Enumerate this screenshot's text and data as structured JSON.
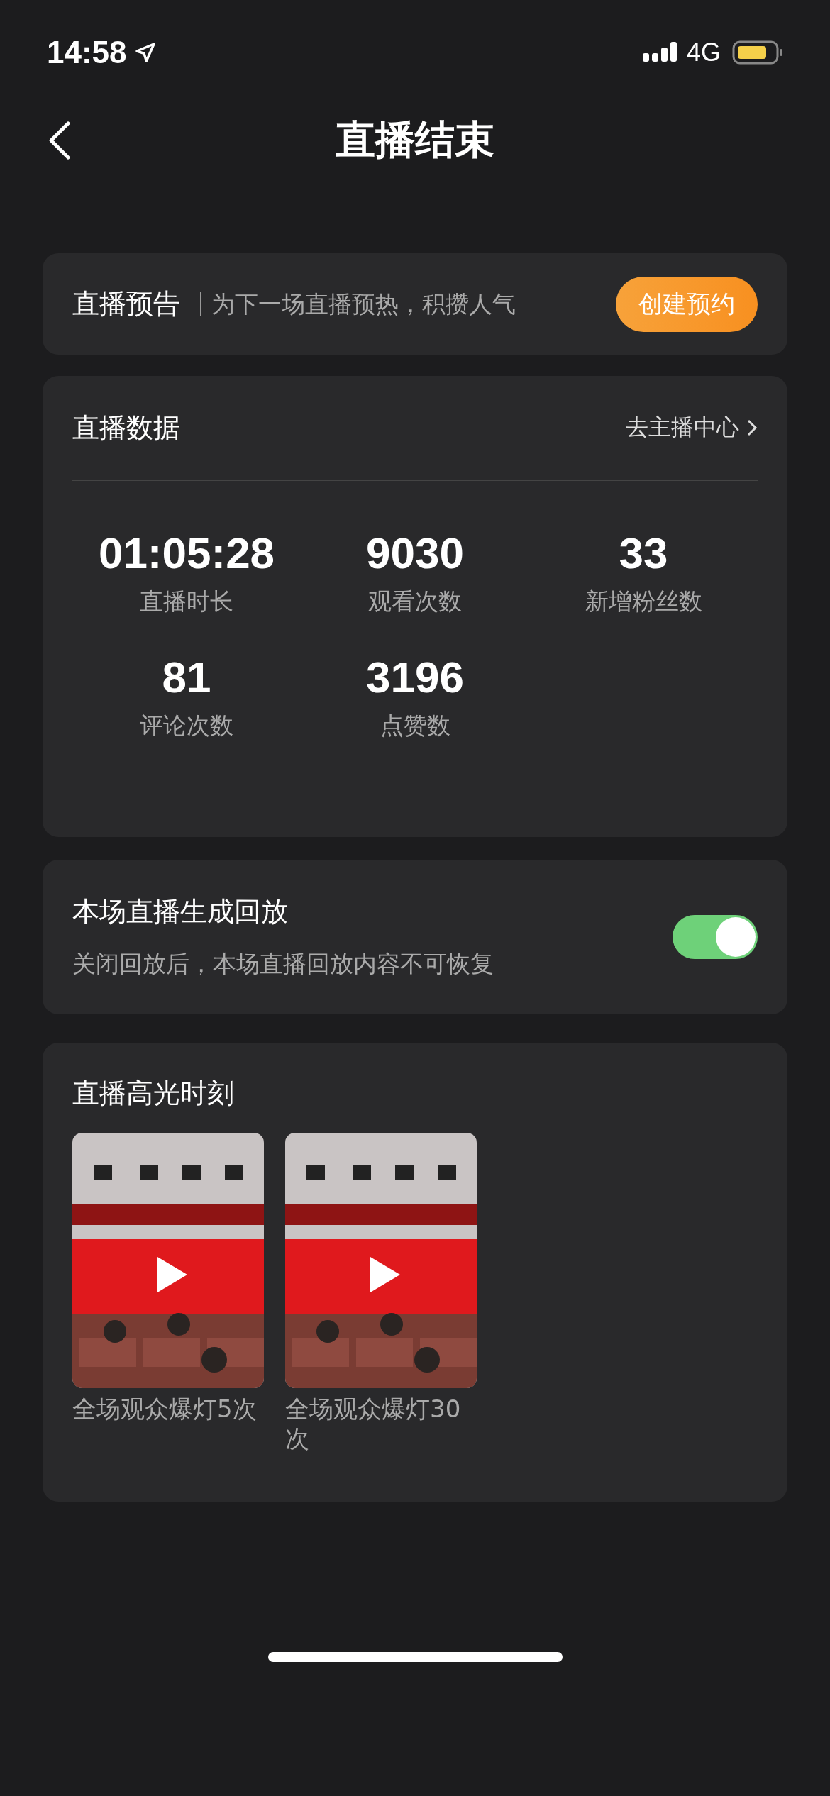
{
  "status_bar": {
    "time": "14:58",
    "network": "4G"
  },
  "nav": {
    "title": "直播结束"
  },
  "preview_card": {
    "title": "直播预告",
    "subtitle": "为下一场直播预热，积攒人气",
    "button": "创建预约"
  },
  "data_card": {
    "title": "直播数据",
    "link": "去主播中心",
    "stats": [
      {
        "value": "01:05:28",
        "label": "直播时长"
      },
      {
        "value": "9030",
        "label": "观看次数"
      },
      {
        "value": "33",
        "label": "新增粉丝数"
      },
      {
        "value": "81",
        "label": "评论次数"
      },
      {
        "value": "3196",
        "label": "点赞数"
      }
    ]
  },
  "replay_card": {
    "title": "本场直播生成回放",
    "subtitle": "关闭回放后，本场直播回放内容不可恢复",
    "on": true
  },
  "highlights_card": {
    "title": "直播高光时刻",
    "clips": [
      {
        "kind": "picture",
        "caption": "全场观众爆灯5次"
      },
      {
        "kind": "picture",
        "caption": "全场观众爆灯30次"
      }
    ]
  }
}
